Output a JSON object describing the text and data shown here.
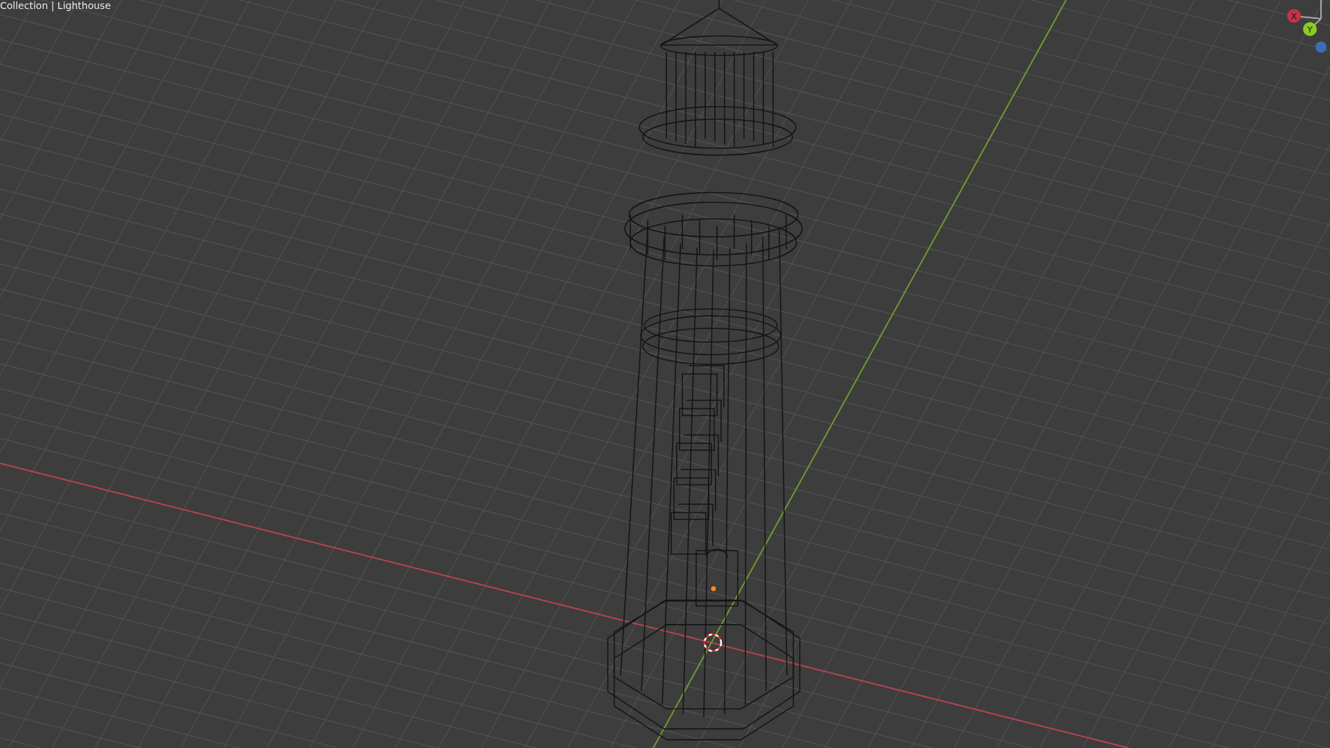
{
  "viewport": {
    "header": "Collection | Lighthouse"
  },
  "gizmo": {
    "axes": [
      {
        "kind": "labeled",
        "label": "X",
        "color": "#c2344a"
      },
      {
        "kind": "labeled",
        "label": "Y",
        "color": "#8ccc1f"
      },
      {
        "kind": "dot",
        "color": "#3a6fb5"
      }
    ]
  }
}
